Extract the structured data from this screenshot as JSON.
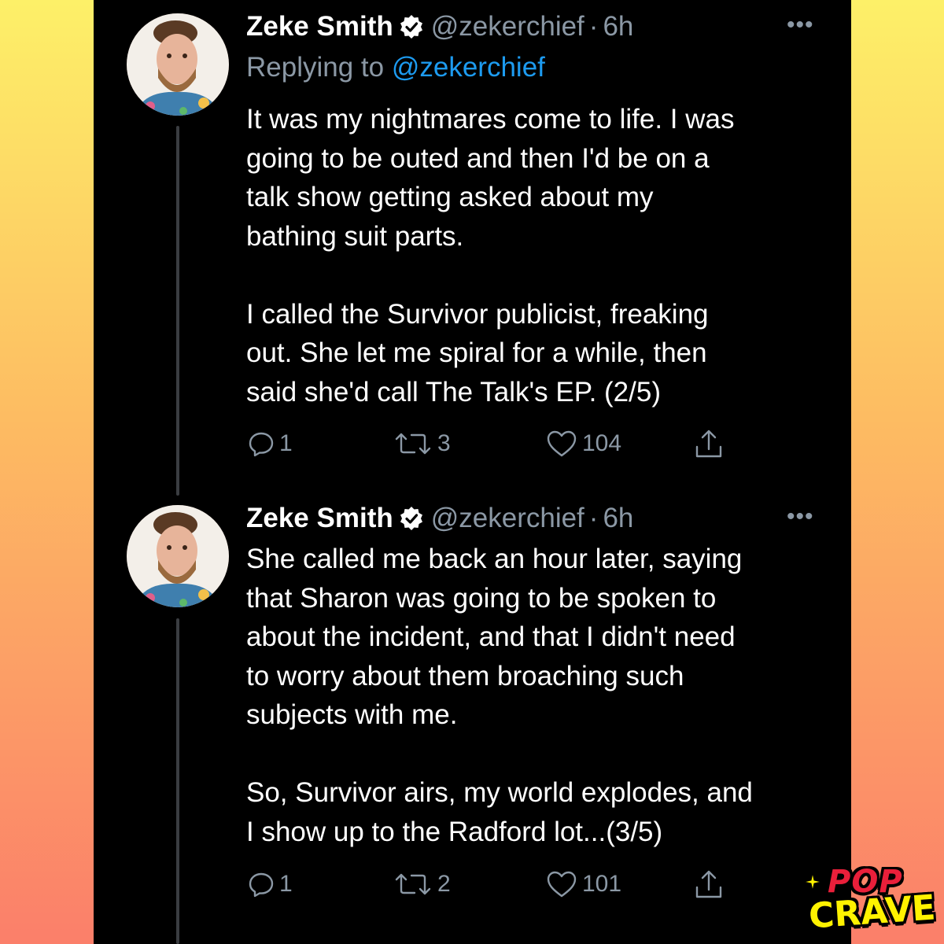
{
  "tweets": [
    {
      "author": {
        "name": "Zeke Smith",
        "handle": "@zekerchief",
        "time": "6h",
        "verified": true
      },
      "replying_prefix": "Replying to",
      "replying_to": "@zekerchief",
      "text": "It was my nightmares come to life. I was\ngoing to be outed and then I'd be on a\ntalk show getting asked about my\nbathing suit parts.\n\nI called the Survivor publicist, freaking\nout. She let me spiral for a while, then\nsaid she'd call The Talk's EP. (2/5)",
      "actions": {
        "replies": "1",
        "retweets": "3",
        "likes": "104"
      }
    },
    {
      "author": {
        "name": "Zeke Smith",
        "handle": "@zekerchief",
        "time": "6h",
        "verified": true
      },
      "text": "She called me back an hour later, saying\nthat Sharon was going to be spoken to\nabout the incident, and that I didn't need\nto worry about them broaching such\nsubjects with me.\n\nSo, Survivor airs, my world explodes, and\nI show up to the Radford lot...(3/5)",
      "actions": {
        "replies": "1",
        "retweets": "2",
        "likes": "101"
      }
    }
  ],
  "separator": "·",
  "watermark": {
    "line1": "POP",
    "line2": "CRAVE"
  },
  "colors": {
    "background_top": "#fdf068",
    "background_bottom": "#fb7f6a",
    "panel": "#000000",
    "text": "#ffffff",
    "secondary": "#8b98a5",
    "link": "#1d9bf0"
  }
}
